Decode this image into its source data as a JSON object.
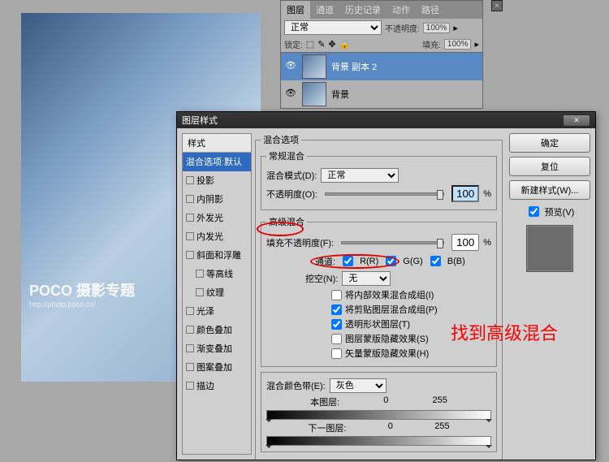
{
  "photo_watermark": "POCO 摄影专题",
  "photo_watermark_url": "http://photo.poco.cn/",
  "layers_panel": {
    "tabs": [
      "图层",
      "通道",
      "历史记录",
      "动作",
      "路径"
    ],
    "blend_mode": "正常",
    "opacity_label": "不透明度:",
    "opacity_value": "100%",
    "lock_label": "锁定:",
    "fill_label": "填充:",
    "fill_value": "100%",
    "layers": [
      {
        "name": "背景 副本 2",
        "selected": true
      },
      {
        "name": "背景",
        "selected": false
      }
    ]
  },
  "dialog": {
    "title": "图层样式",
    "styles_header": "样式",
    "style_items": [
      {
        "label": "混合选项:默认",
        "chk": false,
        "sel": true
      },
      {
        "label": "投影",
        "chk": true,
        "sel": false
      },
      {
        "label": "内阴影",
        "chk": true,
        "sel": false
      },
      {
        "label": "外发光",
        "chk": true,
        "sel": false
      },
      {
        "label": "内发光",
        "chk": true,
        "sel": false
      },
      {
        "label": "斜面和浮雕",
        "chk": true,
        "sel": false
      },
      {
        "label": "等高线",
        "chk": true,
        "sel": false,
        "ind": true
      },
      {
        "label": "纹理",
        "chk": true,
        "sel": false,
        "ind": true
      },
      {
        "label": "光泽",
        "chk": true,
        "sel": false
      },
      {
        "label": "颜色叠加",
        "chk": true,
        "sel": false
      },
      {
        "label": "渐变叠加",
        "chk": true,
        "sel": false
      },
      {
        "label": "图案叠加",
        "chk": true,
        "sel": false
      },
      {
        "label": "描边",
        "chk": true,
        "sel": false
      }
    ],
    "blend_options_title": "混合选项",
    "general_title": "常规混合",
    "blend_mode_label": "混合模式(D):",
    "blend_mode_value": "正常",
    "opacity_label": "不透明度(O):",
    "opacity_value": "100",
    "percent": "%",
    "advanced_title": "高级混合",
    "fill_opacity_label": "填充不透明度(F):",
    "fill_opacity_value": "100",
    "channels_label": "通道:",
    "ch_r": "R(R)",
    "ch_g": "G(G)",
    "ch_b": "B(B)",
    "knockout_label": "挖空(N):",
    "knockout_value": "无",
    "adv_checks": [
      {
        "label": "将内部效果混合成组(I)",
        "chk": false
      },
      {
        "label": "将剪贴图层混合成组(P)",
        "chk": true
      },
      {
        "label": "透明形状图层(T)",
        "chk": true
      },
      {
        "label": "图层蒙版隐藏效果(S)",
        "chk": false
      },
      {
        "label": "矢量蒙版隐藏效果(H)",
        "chk": false
      }
    ],
    "blend_if_title": "混合颜色带(E):",
    "blend_if_value": "灰色",
    "this_layer": "本图层:",
    "under_layer": "下一图层:",
    "range_lo": "0",
    "range_hi": "255",
    "ok": "确定",
    "cancel": "复位",
    "new_style": "新建样式(W)...",
    "preview": "预览(V)"
  },
  "annotation": "找到高级混合"
}
